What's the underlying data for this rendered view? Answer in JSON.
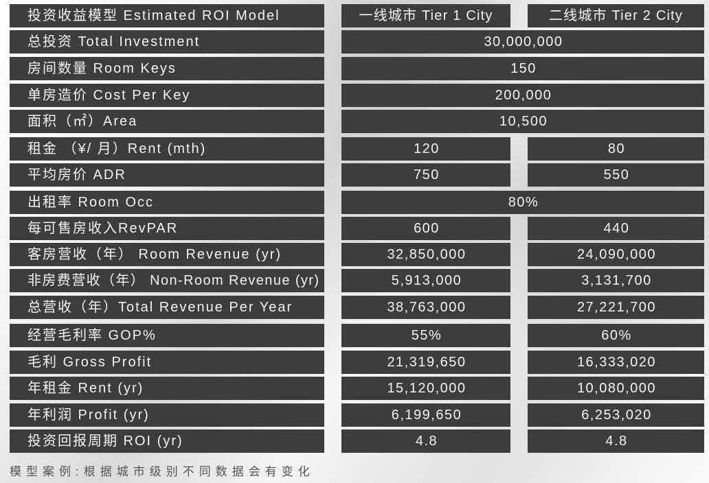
{
  "chart_data": {
    "type": "table",
    "title": "投资收益模型 Estimated ROI Model",
    "columns": [
      "一线城市 Tier 1 City",
      "二线城市 Tier 2 City"
    ],
    "rows": [
      {
        "label": "总投资 Total Investment",
        "shared": "30,000,000"
      },
      {
        "label": "房间数量 Room Keys",
        "shared": "150"
      },
      {
        "label": "单房造价 Cost Per Key",
        "shared": "200,000"
      },
      {
        "label": "面积（㎡）Area",
        "shared": "10,500"
      },
      {
        "label": "租金 （¥/ 月）Rent (mth)",
        "tier1": "120",
        "tier2": "80"
      },
      {
        "label": "平均房价 ADR",
        "tier1": "750",
        "tier2": "550"
      },
      {
        "label": "出租率 Room Occ",
        "shared": "80%"
      },
      {
        "label": "每可售房收入RevPAR",
        "tier1": "600",
        "tier2": "440"
      },
      {
        "label": "客房营收（年） Room Revenue (yr)",
        "tier1": "32,850,000",
        "tier2": "24,090,000"
      },
      {
        "label": "非房费营收（年） Non-Room Revenue (yr)",
        "tier1": "5,913,000",
        "tier2": "3,131,700"
      },
      {
        "label": "总营收（年）Total Revenue Per Year",
        "tier1": "38,763,000",
        "tier2": "27,221,700"
      },
      {
        "label": "经营毛利率 GOP%",
        "tier1": "55%",
        "tier2": "60%"
      },
      {
        "label": "毛利 Gross Profit",
        "tier1": "21,319,650",
        "tier2": "16,333,020"
      },
      {
        "label": "年租金 Rent (yr)",
        "tier1": "15,120,000",
        "tier2": "10,080,000"
      },
      {
        "label": "年利润 Profit (yr)",
        "tier1": "6,199,650",
        "tier2": "6,253,020"
      },
      {
        "label": "投资回报周期 ROI (yr)",
        "tier1": "4.8",
        "tier2": "4.8"
      }
    ],
    "note": "模型案例:根据城市级别不同数据会有变化"
  },
  "colors": {
    "cell_background": "#3d3d3d",
    "cell_text": "#f4f4f4",
    "note_text": "#555555"
  }
}
